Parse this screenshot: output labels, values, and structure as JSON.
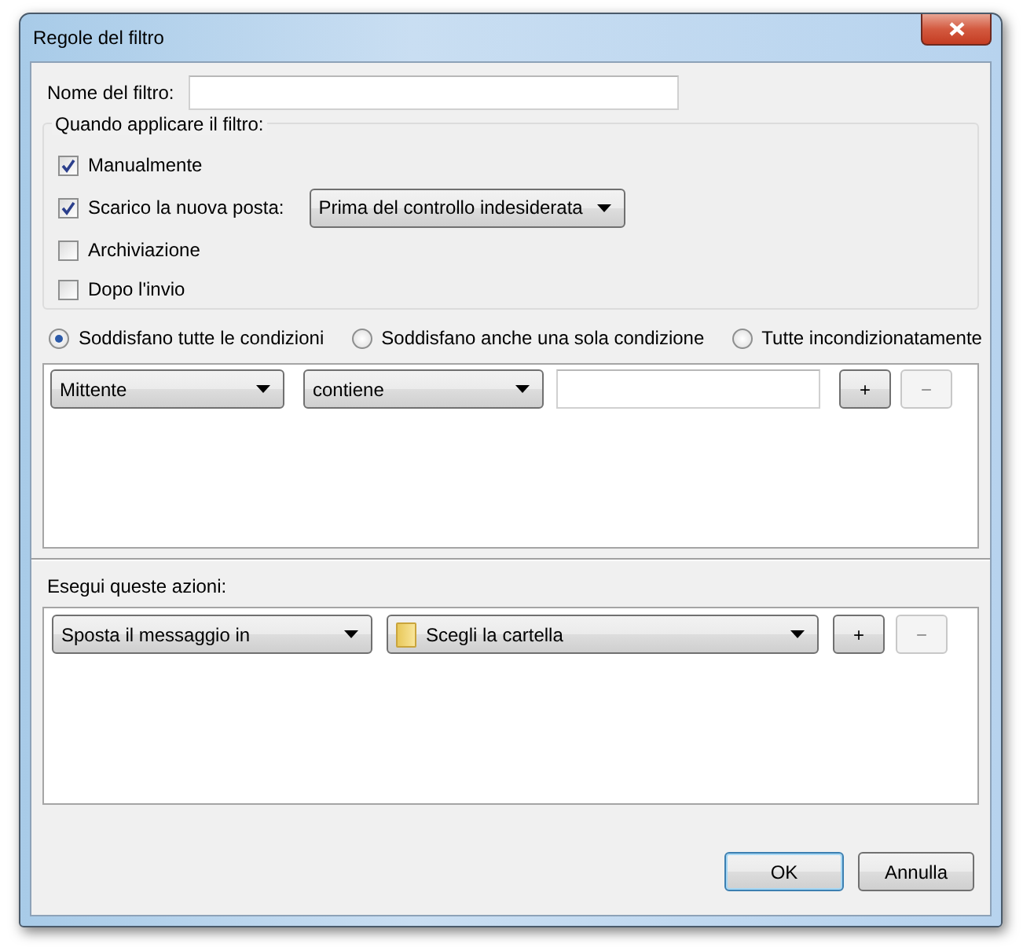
{
  "window": {
    "title": "Regole del filtro"
  },
  "filter_name": {
    "label": "Nome del filtro:"
  },
  "when": {
    "label": "Quando applicare il filtro:",
    "options": [
      {
        "label": "Manualmente",
        "checked": true
      },
      {
        "label": "Scarico la nuova posta:",
        "checked": true,
        "dropdown": "Prima del controllo indesiderata"
      },
      {
        "label": "Archiviazione",
        "checked": false
      },
      {
        "label": "Dopo l'invio",
        "checked": false
      }
    ]
  },
  "match": [
    {
      "label": "Soddisfano tutte le condizioni",
      "selected": true
    },
    {
      "label": "Soddisfano anche una sola condizione",
      "selected": false
    },
    {
      "label": "Tutte incondizionatamente",
      "selected": false
    }
  ],
  "conditions": [
    {
      "field": "Mittente",
      "operator": "contiene",
      "add": "+",
      "remove": "−",
      "remove_disabled": true
    }
  ],
  "actions": {
    "label": "Esegui queste azioni:",
    "rows": [
      {
        "action": "Sposta il messaggio in",
        "target": "Scegli la cartella",
        "add": "+",
        "remove": "−",
        "remove_disabled": true
      }
    ]
  },
  "buttons": [
    {
      "label": "OK",
      "default": true
    },
    {
      "label": "Annulla",
      "default": false
    }
  ]
}
